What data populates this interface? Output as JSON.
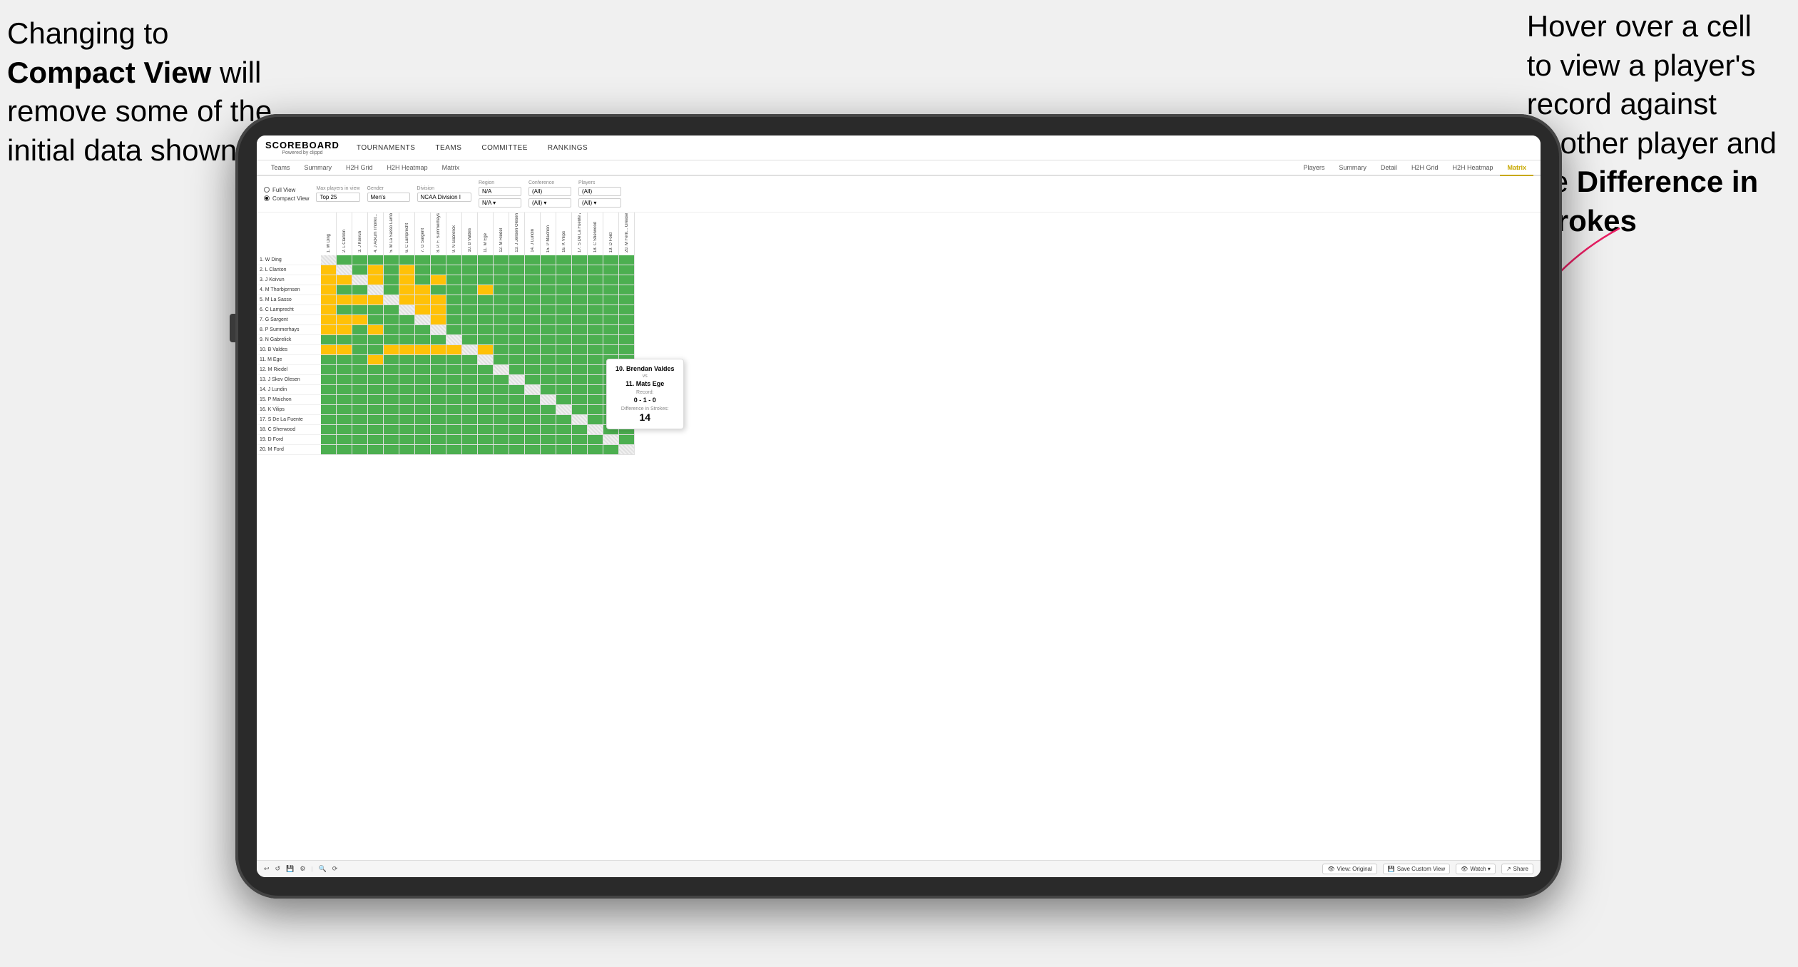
{
  "annotations": {
    "left": {
      "line1": "Changing to",
      "line2bold": "Compact View",
      "line2rest": " will",
      "line3": "remove some of the",
      "line4": "initial data shown"
    },
    "right": {
      "line1": "Hover over a cell",
      "line2": "to view a player's",
      "line3": "record against",
      "line4": "another player and",
      "line5pre": "the ",
      "line5bold": "Difference in",
      "line6bold": "Strokes"
    }
  },
  "app": {
    "logo": "SCOREBOARD",
    "logo_sub": "Powered by clippd",
    "nav": [
      "TOURNAMENTS",
      "TEAMS",
      "COMMITTEE",
      "RANKINGS"
    ],
    "tabs_top": [
      "Teams",
      "Summary",
      "H2H Grid",
      "H2H Heatmap",
      "Matrix"
    ],
    "tabs_players": [
      "Players",
      "Summary",
      "Detail",
      "H2H Grid",
      "H2H Heatmap",
      "Matrix"
    ],
    "active_tab": "Matrix"
  },
  "controls": {
    "view_options": [
      "Full View",
      "Compact View"
    ],
    "active_view": "Compact View",
    "max_players_label": "Max players in view",
    "max_players_value": "Top 25",
    "gender_label": "Gender",
    "gender_value": "Men's",
    "division_label": "Division",
    "division_value": "NCAA Division I",
    "region_label": "Region",
    "region_value": "N/A",
    "conference_label": "Conference",
    "conference_value": "(All)",
    "players_label": "Players",
    "players_value": "(All)"
  },
  "players": [
    "1. W Ding",
    "2. L Clanton",
    "3. J Koivun",
    "4. M Thorbjornsen",
    "5. M La Sasso",
    "6. C Lamprecht",
    "7. G Sargent",
    "8. P Summerhays",
    "9. N Gabrelick",
    "10. B Valdes",
    "11. M Ege",
    "12. M Riedel",
    "13. J Skov Olesen",
    "14. J Lundin",
    "15. P Maichon",
    "16. K Vilips",
    "17. S De La Fuente",
    "18. C Sherwood",
    "19. D Ford",
    "20. M Ford"
  ],
  "col_headers": [
    "1. W Ding",
    "2. L Clanton",
    "3. J Koivun",
    "4. J Ackum Thorkil...",
    "5. M La Sasso Lamb... C...",
    "6. C Lamprecht",
    "7. G Sargent",
    "8. P. F. Summerhays",
    "9. N Gabrelick",
    "10. B Valdes",
    "11. M Ege",
    "12. M Riedel",
    "13. J Jensen Olesen",
    "14. J Lundin",
    "15. P Maichon",
    "16. K Vilips",
    "17. S De La Fuente Zherwood",
    "18. C Sherwood",
    "19. D Ford",
    "20. M Fern... Greaser"
  ],
  "tooltip": {
    "player1": "10. Brendan Valdes",
    "vs": "vs",
    "player2": "11. Mats Ege",
    "record_label": "Record:",
    "record": "0 - 1 - 0",
    "diff_label": "Difference in Strokes:",
    "diff": "14"
  },
  "toolbar": {
    "undo": "↩",
    "redo": "↪",
    "view_original": "View: Original",
    "save_custom": "Save Custom View",
    "watch": "Watch ▾",
    "share": "Share"
  },
  "colors": {
    "green": "#4caf50",
    "dark_green": "#388e3c",
    "yellow": "#ffc107",
    "gray": "#bdbdbd",
    "white": "#ffffff",
    "diag": "#e8e8e8",
    "accent": "#c8a800"
  },
  "grid": {
    "rows": 20,
    "cols": 20,
    "pattern": [
      [
        "d",
        "g",
        "g",
        "g",
        "g",
        "g",
        "g",
        "g",
        "g",
        "g",
        "g",
        "g",
        "g",
        "g",
        "g",
        "g",
        "g",
        "g",
        "g",
        "g"
      ],
      [
        "y",
        "d",
        "g",
        "y",
        "g",
        "y",
        "g",
        "g",
        "g",
        "g",
        "g",
        "g",
        "g",
        "g",
        "g",
        "g",
        "g",
        "g",
        "g",
        "g"
      ],
      [
        "y",
        "y",
        "d",
        "y",
        "g",
        "y",
        "g",
        "y",
        "g",
        "g",
        "g",
        "g",
        "g",
        "g",
        "g",
        "g",
        "g",
        "g",
        "g",
        "g"
      ],
      [
        "y",
        "g",
        "g",
        "d",
        "g",
        "y",
        "y",
        "g",
        "g",
        "g",
        "y",
        "g",
        "g",
        "g",
        "g",
        "g",
        "g",
        "g",
        "g",
        "g"
      ],
      [
        "y",
        "y",
        "y",
        "y",
        "d",
        "y",
        "y",
        "y",
        "g",
        "g",
        "g",
        "g",
        "g",
        "g",
        "g",
        "g",
        "g",
        "g",
        "g",
        "g"
      ],
      [
        "y",
        "g",
        "g",
        "g",
        "g",
        "d",
        "y",
        "y",
        "g",
        "g",
        "g",
        "g",
        "g",
        "g",
        "g",
        "g",
        "g",
        "g",
        "g",
        "g"
      ],
      [
        "y",
        "y",
        "y",
        "g",
        "g",
        "g",
        "d",
        "y",
        "g",
        "g",
        "g",
        "g",
        "g",
        "g",
        "g",
        "g",
        "g",
        "g",
        "g",
        "g"
      ],
      [
        "y",
        "y",
        "g",
        "y",
        "g",
        "g",
        "g",
        "d",
        "g",
        "g",
        "g",
        "g",
        "g",
        "g",
        "g",
        "g",
        "g",
        "g",
        "g",
        "g"
      ],
      [
        "g",
        "g",
        "g",
        "g",
        "g",
        "g",
        "g",
        "g",
        "d",
        "g",
        "g",
        "g",
        "g",
        "g",
        "g",
        "g",
        "g",
        "g",
        "g",
        "g"
      ],
      [
        "y",
        "y",
        "g",
        "g",
        "y",
        "y",
        "y",
        "y",
        "y",
        "d",
        "y",
        "g",
        "g",
        "g",
        "g",
        "g",
        "g",
        "g",
        "g",
        "g"
      ],
      [
        "g",
        "g",
        "g",
        "y",
        "g",
        "g",
        "g",
        "g",
        "g",
        "g",
        "d",
        "g",
        "g",
        "g",
        "g",
        "g",
        "g",
        "g",
        "g",
        "g"
      ],
      [
        "g",
        "g",
        "g",
        "g",
        "g",
        "g",
        "g",
        "g",
        "g",
        "g",
        "g",
        "d",
        "g",
        "g",
        "g",
        "g",
        "g",
        "g",
        "g",
        "g"
      ],
      [
        "g",
        "g",
        "g",
        "g",
        "g",
        "g",
        "g",
        "g",
        "g",
        "g",
        "g",
        "g",
        "d",
        "g",
        "g",
        "g",
        "g",
        "g",
        "g",
        "g"
      ],
      [
        "g",
        "g",
        "g",
        "g",
        "g",
        "g",
        "g",
        "g",
        "g",
        "g",
        "g",
        "g",
        "g",
        "d",
        "g",
        "g",
        "g",
        "g",
        "g",
        "g"
      ],
      [
        "g",
        "g",
        "g",
        "g",
        "g",
        "g",
        "g",
        "g",
        "g",
        "g",
        "g",
        "g",
        "g",
        "g",
        "d",
        "g",
        "g",
        "g",
        "g",
        "g"
      ],
      [
        "g",
        "g",
        "g",
        "g",
        "g",
        "g",
        "g",
        "g",
        "g",
        "g",
        "g",
        "g",
        "g",
        "g",
        "g",
        "d",
        "g",
        "g",
        "g",
        "g"
      ],
      [
        "g",
        "g",
        "g",
        "g",
        "g",
        "g",
        "g",
        "g",
        "g",
        "g",
        "g",
        "g",
        "g",
        "g",
        "g",
        "g",
        "d",
        "g",
        "g",
        "g"
      ],
      [
        "g",
        "g",
        "g",
        "g",
        "g",
        "g",
        "g",
        "g",
        "g",
        "g",
        "g",
        "g",
        "g",
        "g",
        "g",
        "g",
        "g",
        "d",
        "g",
        "g"
      ],
      [
        "g",
        "g",
        "g",
        "g",
        "g",
        "g",
        "g",
        "g",
        "g",
        "g",
        "g",
        "g",
        "g",
        "g",
        "g",
        "g",
        "g",
        "g",
        "d",
        "g"
      ],
      [
        "g",
        "g",
        "g",
        "g",
        "g",
        "g",
        "g",
        "g",
        "g",
        "g",
        "g",
        "g",
        "g",
        "g",
        "g",
        "g",
        "g",
        "g",
        "g",
        "d"
      ]
    ]
  }
}
